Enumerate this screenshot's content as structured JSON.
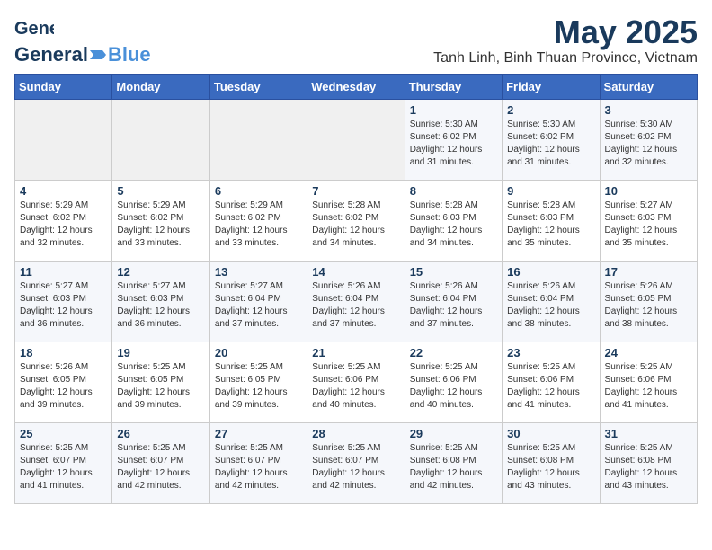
{
  "header": {
    "logo_general": "General",
    "logo_blue": "Blue",
    "month": "May 2025",
    "location": "Tanh Linh, Binh Thuan Province, Vietnam"
  },
  "weekdays": [
    "Sunday",
    "Monday",
    "Tuesday",
    "Wednesday",
    "Thursday",
    "Friday",
    "Saturday"
  ],
  "weeks": [
    [
      {
        "day": "",
        "info": ""
      },
      {
        "day": "",
        "info": ""
      },
      {
        "day": "",
        "info": ""
      },
      {
        "day": "",
        "info": ""
      },
      {
        "day": "1",
        "info": "Sunrise: 5:30 AM\nSunset: 6:02 PM\nDaylight: 12 hours\nand 31 minutes."
      },
      {
        "day": "2",
        "info": "Sunrise: 5:30 AM\nSunset: 6:02 PM\nDaylight: 12 hours\nand 31 minutes."
      },
      {
        "day": "3",
        "info": "Sunrise: 5:30 AM\nSunset: 6:02 PM\nDaylight: 12 hours\nand 32 minutes."
      }
    ],
    [
      {
        "day": "4",
        "info": "Sunrise: 5:29 AM\nSunset: 6:02 PM\nDaylight: 12 hours\nand 32 minutes."
      },
      {
        "day": "5",
        "info": "Sunrise: 5:29 AM\nSunset: 6:02 PM\nDaylight: 12 hours\nand 33 minutes."
      },
      {
        "day": "6",
        "info": "Sunrise: 5:29 AM\nSunset: 6:02 PM\nDaylight: 12 hours\nand 33 minutes."
      },
      {
        "day": "7",
        "info": "Sunrise: 5:28 AM\nSunset: 6:02 PM\nDaylight: 12 hours\nand 34 minutes."
      },
      {
        "day": "8",
        "info": "Sunrise: 5:28 AM\nSunset: 6:03 PM\nDaylight: 12 hours\nand 34 minutes."
      },
      {
        "day": "9",
        "info": "Sunrise: 5:28 AM\nSunset: 6:03 PM\nDaylight: 12 hours\nand 35 minutes."
      },
      {
        "day": "10",
        "info": "Sunrise: 5:27 AM\nSunset: 6:03 PM\nDaylight: 12 hours\nand 35 minutes."
      }
    ],
    [
      {
        "day": "11",
        "info": "Sunrise: 5:27 AM\nSunset: 6:03 PM\nDaylight: 12 hours\nand 36 minutes."
      },
      {
        "day": "12",
        "info": "Sunrise: 5:27 AM\nSunset: 6:03 PM\nDaylight: 12 hours\nand 36 minutes."
      },
      {
        "day": "13",
        "info": "Sunrise: 5:27 AM\nSunset: 6:04 PM\nDaylight: 12 hours\nand 37 minutes."
      },
      {
        "day": "14",
        "info": "Sunrise: 5:26 AM\nSunset: 6:04 PM\nDaylight: 12 hours\nand 37 minutes."
      },
      {
        "day": "15",
        "info": "Sunrise: 5:26 AM\nSunset: 6:04 PM\nDaylight: 12 hours\nand 37 minutes."
      },
      {
        "day": "16",
        "info": "Sunrise: 5:26 AM\nSunset: 6:04 PM\nDaylight: 12 hours\nand 38 minutes."
      },
      {
        "day": "17",
        "info": "Sunrise: 5:26 AM\nSunset: 6:05 PM\nDaylight: 12 hours\nand 38 minutes."
      }
    ],
    [
      {
        "day": "18",
        "info": "Sunrise: 5:26 AM\nSunset: 6:05 PM\nDaylight: 12 hours\nand 39 minutes."
      },
      {
        "day": "19",
        "info": "Sunrise: 5:25 AM\nSunset: 6:05 PM\nDaylight: 12 hours\nand 39 minutes."
      },
      {
        "day": "20",
        "info": "Sunrise: 5:25 AM\nSunset: 6:05 PM\nDaylight: 12 hours\nand 39 minutes."
      },
      {
        "day": "21",
        "info": "Sunrise: 5:25 AM\nSunset: 6:06 PM\nDaylight: 12 hours\nand 40 minutes."
      },
      {
        "day": "22",
        "info": "Sunrise: 5:25 AM\nSunset: 6:06 PM\nDaylight: 12 hours\nand 40 minutes."
      },
      {
        "day": "23",
        "info": "Sunrise: 5:25 AM\nSunset: 6:06 PM\nDaylight: 12 hours\nand 41 minutes."
      },
      {
        "day": "24",
        "info": "Sunrise: 5:25 AM\nSunset: 6:06 PM\nDaylight: 12 hours\nand 41 minutes."
      }
    ],
    [
      {
        "day": "25",
        "info": "Sunrise: 5:25 AM\nSunset: 6:07 PM\nDaylight: 12 hours\nand 41 minutes."
      },
      {
        "day": "26",
        "info": "Sunrise: 5:25 AM\nSunset: 6:07 PM\nDaylight: 12 hours\nand 42 minutes."
      },
      {
        "day": "27",
        "info": "Sunrise: 5:25 AM\nSunset: 6:07 PM\nDaylight: 12 hours\nand 42 minutes."
      },
      {
        "day": "28",
        "info": "Sunrise: 5:25 AM\nSunset: 6:07 PM\nDaylight: 12 hours\nand 42 minutes."
      },
      {
        "day": "29",
        "info": "Sunrise: 5:25 AM\nSunset: 6:08 PM\nDaylight: 12 hours\nand 42 minutes."
      },
      {
        "day": "30",
        "info": "Sunrise: 5:25 AM\nSunset: 6:08 PM\nDaylight: 12 hours\nand 43 minutes."
      },
      {
        "day": "31",
        "info": "Sunrise: 5:25 AM\nSunset: 6:08 PM\nDaylight: 12 hours\nand 43 minutes."
      }
    ]
  ]
}
